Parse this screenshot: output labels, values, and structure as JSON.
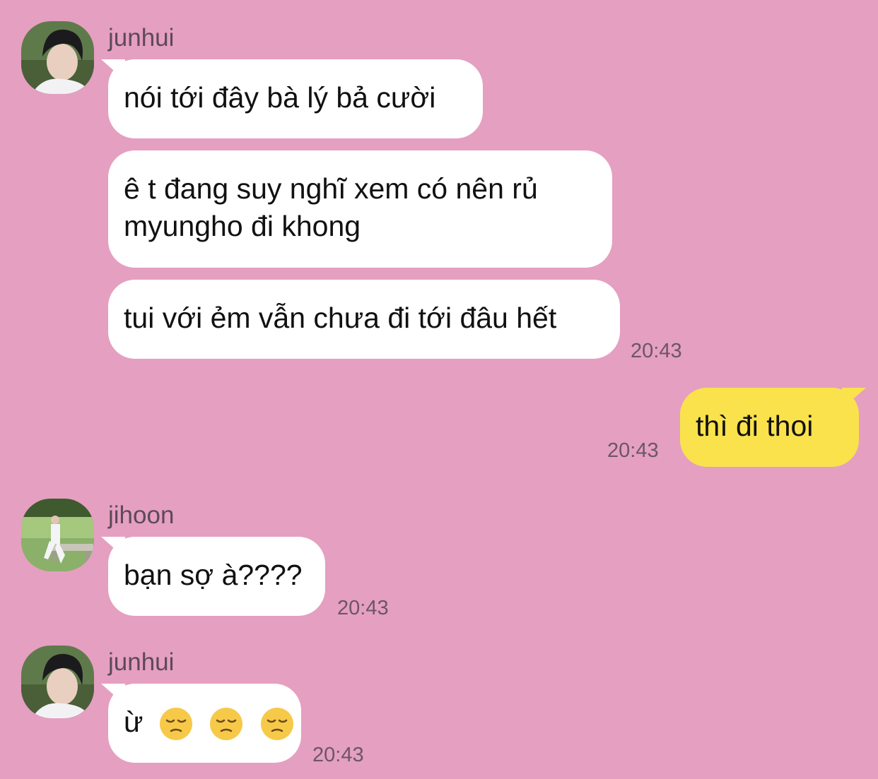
{
  "messages": [
    {
      "sender": "junhui",
      "lines": [
        "nói tới đây bà lý bả cười",
        "ê t đang suy nghĩ xem có nên rủ myungho đi khong",
        "tui với ẻm vẫn chưa đi tới đâu hết"
      ],
      "time": "20:43"
    },
    {
      "sender": "me",
      "text": "thì đi thoi",
      "time": "20:43"
    },
    {
      "sender": "jihoon",
      "text": "bạn sợ à????",
      "time": "20:43"
    },
    {
      "sender": "junhui",
      "text": "ừ",
      "emoji": [
        "pensive-face",
        "pensive-face",
        "pensive-face"
      ],
      "time": "20:43"
    }
  ],
  "colors": {
    "background": "#e59fc1",
    "incoming_bubble": "#ffffff",
    "outgoing_bubble": "#f9e24c",
    "meta_text": "#6b5763"
  }
}
